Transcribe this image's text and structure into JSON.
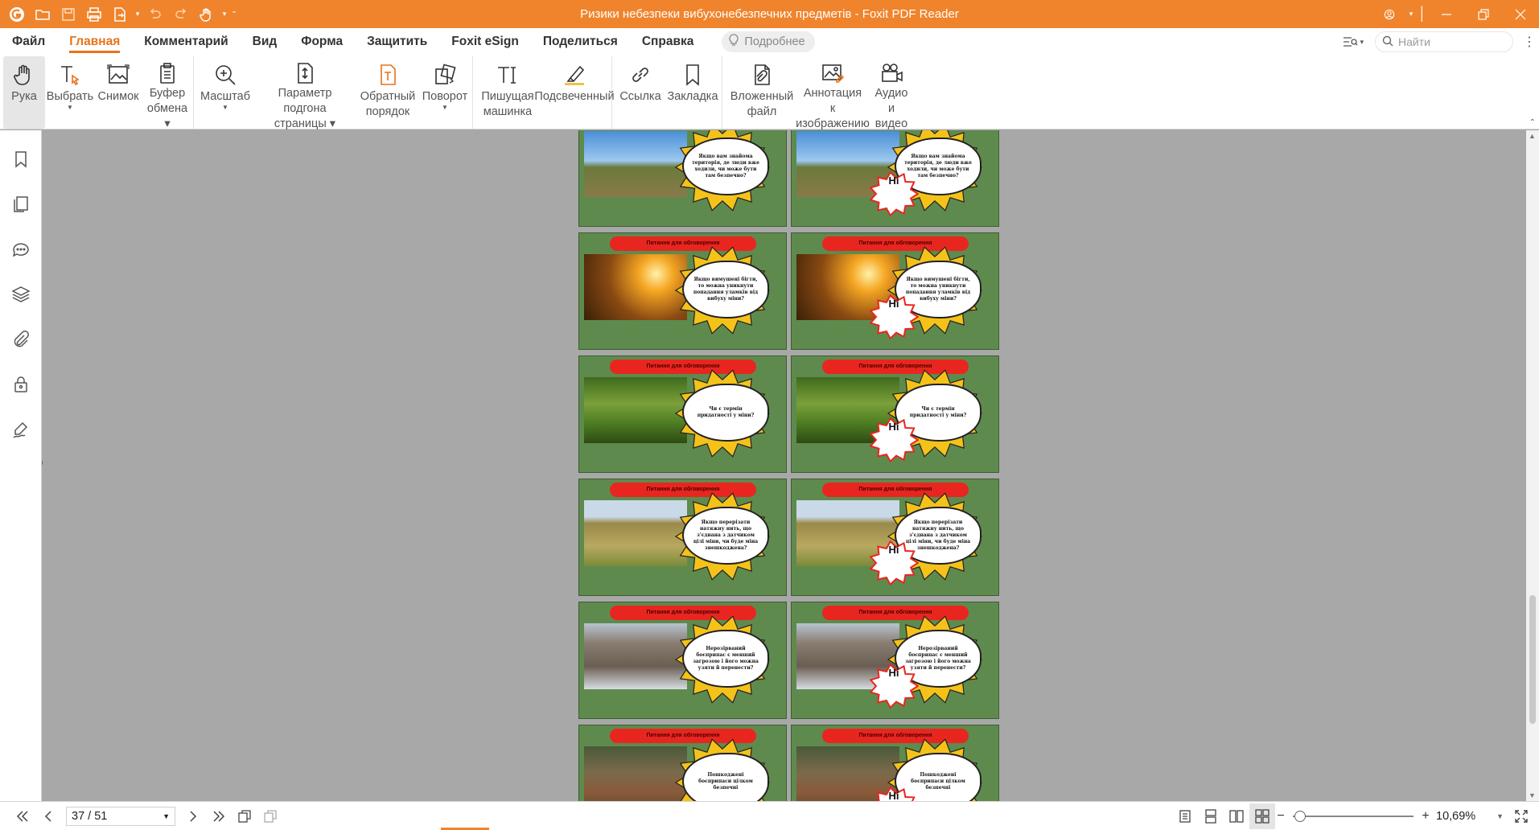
{
  "title_bar": {
    "title": "Ризики небезпеки вибухонебезпечних предметів - Foxit PDF Reader",
    "quick_access": [
      "app-logo-icon",
      "open-icon",
      "save-icon",
      "print-icon",
      "export-icon",
      "undo-icon",
      "redo-icon",
      "hand-icon"
    ]
  },
  "menu": {
    "items": [
      {
        "label": "Файл",
        "active": false
      },
      {
        "label": "Главная",
        "active": true
      },
      {
        "label": "Комментарий",
        "active": false
      },
      {
        "label": "Вид",
        "active": false
      },
      {
        "label": "Форма",
        "active": false
      },
      {
        "label": "Защитить",
        "active": false
      },
      {
        "label": "Foxit eSign",
        "active": false
      },
      {
        "label": "Поделиться",
        "active": false
      },
      {
        "label": "Справка",
        "active": false
      }
    ],
    "more_label": "Подробнее",
    "search_placeholder": "Найти"
  },
  "ribbon": {
    "hand": "Рука",
    "select_l1": "Выбрать",
    "snapshot": "Снимок",
    "clipboard_l1": "Буфер",
    "clipboard_l2": "обмена",
    "zoom": "Масштаб",
    "fit_l1": "Параметр подгона",
    "fit_l2": "страницы",
    "reverse_l1": "Обратный",
    "reverse_l2": "порядок",
    "rotate": "Поворот",
    "typewriter_l1": "Пишущая",
    "typewriter_l2": "машинка",
    "highlight": "Подсвеченный",
    "link": "Ссылка",
    "bookmark": "Закладка",
    "attach_l1": "Вложенный",
    "attach_l2": "файл",
    "image_annot_l1": "Аннотация к",
    "image_annot_l2": "изображению",
    "media_l1": "Аудио",
    "media_l2": "и видео"
  },
  "sidebar_icons": [
    "bookmark-icon",
    "pages-icon",
    "comments-icon",
    "layers-icon",
    "attachments-icon",
    "security-icon",
    "signature-icon"
  ],
  "slides": {
    "banner": "Питання для обговорення",
    "answer": "Ні",
    "rows": [
      {
        "question": "Якщо вам знайома територія, де люди вже ходили, чи може бути там безпечно?",
        "photo": "field"
      },
      {
        "question": "Якщо вимушені бігти, то можна уникнути попадання уламків від вибуху міни?",
        "photo": "runner"
      },
      {
        "question": "Чи є термін придатності у міни?",
        "photo": "grass"
      },
      {
        "question": "Якщо перерізати натяжну нить, що з'єднана з датчиком цілі міни, чи буде міна знешкоджена?",
        "photo": "grenade"
      },
      {
        "question": "Нерозірваний боєприпас є менший загрозою і його можна узяти й перенести?",
        "photo": "building"
      },
      {
        "question": "Пошкоджені боєприпаси цілком безпечні",
        "photo": "ammo"
      }
    ]
  },
  "status": {
    "page": "37 / 51",
    "zoom": "10,69%"
  },
  "colors": {
    "accent": "#f0842c",
    "menu_active": "#e8731c",
    "slide_bg": "#5f8a4e",
    "banner": "#e8261f"
  }
}
